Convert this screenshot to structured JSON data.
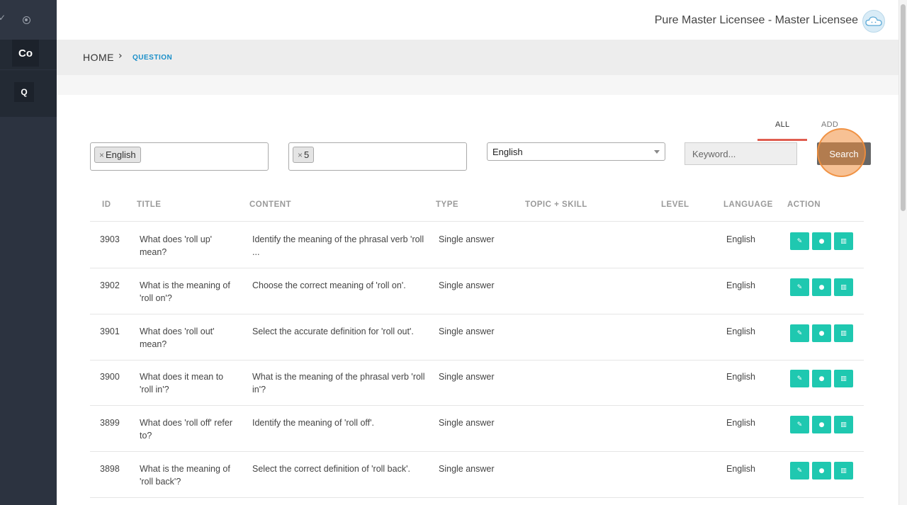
{
  "sidebar": {
    "items": [
      {
        "label": "Co"
      },
      {
        "label": "Q"
      }
    ]
  },
  "header": {
    "user_name": "Pure Master Licensee - Master Licensee"
  },
  "breadcrumb": {
    "home": "HOME",
    "separator": "›",
    "current": "QUESTION"
  },
  "tabs": [
    {
      "label": "ALL",
      "active": true
    },
    {
      "label": "ADD",
      "active": false
    }
  ],
  "filters": {
    "language_tag": "English",
    "level_tag": "5",
    "tag_remove": "×",
    "language_select": "English",
    "keyword_placeholder": "Keyword...",
    "search_label": "Search"
  },
  "table": {
    "columns": [
      "ID",
      "TITLE",
      "CONTENT",
      "TYPE",
      "TOPIC + SKILL",
      "LEVEL",
      "LANGUAGE",
      "ACTION"
    ],
    "rows": [
      {
        "id": "3903",
        "title": "What does 'roll up' mean?",
        "content": "Identify the meaning of the phrasal verb 'roll ...",
        "type": "Single answer",
        "topic": "",
        "level": "",
        "language": "English"
      },
      {
        "id": "3902",
        "title": "What is the meaning of 'roll on'?",
        "content": "Choose the correct meaning of 'roll on'.",
        "type": "Single answer",
        "topic": "",
        "level": "",
        "language": "English"
      },
      {
        "id": "3901",
        "title": "What does 'roll out' mean?",
        "content": "Select the accurate definition for 'roll out'.",
        "type": "Single answer",
        "topic": "",
        "level": "",
        "language": "English"
      },
      {
        "id": "3900",
        "title": "What does it mean to 'roll in'?",
        "content": "What is the meaning of the phrasal verb 'roll in'?",
        "type": "Single answer",
        "topic": "",
        "level": "",
        "language": "English"
      },
      {
        "id": "3899",
        "title": "What does 'roll off' refer to?",
        "content": "Identify the meaning of 'roll off'.",
        "type": "Single answer",
        "topic": "",
        "level": "",
        "language": "English"
      },
      {
        "id": "3898",
        "title": "What is the meaning of 'roll back'?",
        "content": "Select the correct definition of 'roll back'.",
        "type": "Single answer",
        "topic": "",
        "level": "",
        "language": "English"
      }
    ],
    "action_icons": [
      "edit-icon",
      "comment-icon",
      "trash-icon"
    ]
  },
  "colors": {
    "sidebar_bg": "#2c3340",
    "accent_link": "#1a8fc9",
    "tab_underline": "#e05d50",
    "action_button": "#1fc8b0",
    "search_button": "#666666",
    "click_highlight": "#f08e3c"
  }
}
